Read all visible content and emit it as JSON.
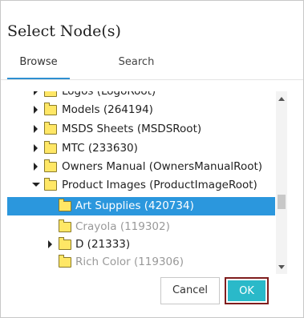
{
  "dialog": {
    "title": "Select Node(s)"
  },
  "tabs": [
    {
      "label": "Browse",
      "active": true
    },
    {
      "label": "Search",
      "active": false
    }
  ],
  "tree": {
    "rows": [
      {
        "label": "Logos (LogoRoot)",
        "arrow": "right",
        "dim": false,
        "selected": false
      },
      {
        "label": "Models (264194)",
        "arrow": "right",
        "dim": false,
        "selected": false
      },
      {
        "label": "MSDS Sheets (MSDSRoot)",
        "arrow": "right",
        "dim": false,
        "selected": false
      },
      {
        "label": "MTC (233630)",
        "arrow": "right",
        "dim": false,
        "selected": false
      },
      {
        "label": "Owners Manual (OwnersManualRoot)",
        "arrow": "right",
        "dim": false,
        "selected": false
      },
      {
        "label": "Product Images (ProductImageRoot)",
        "arrow": "down",
        "dim": false,
        "selected": false
      },
      {
        "label": "Art Supplies (420734)",
        "arrow": "none",
        "dim": false,
        "selected": true
      },
      {
        "label": "Crayola (119302)",
        "arrow": "none",
        "dim": true,
        "selected": false
      },
      {
        "label": "D (21333)",
        "arrow": "right",
        "dim": false,
        "selected": false
      },
      {
        "label": "Rich Color (119306)",
        "arrow": "none",
        "dim": true,
        "selected": false
      }
    ]
  },
  "buttons": {
    "cancel": "Cancel",
    "ok": "OK"
  },
  "colors": {
    "accent": "#2b97dd",
    "ok_button": "#2ab9c9",
    "focus_ring": "#7f1d1d",
    "folder": "#ffe766"
  }
}
